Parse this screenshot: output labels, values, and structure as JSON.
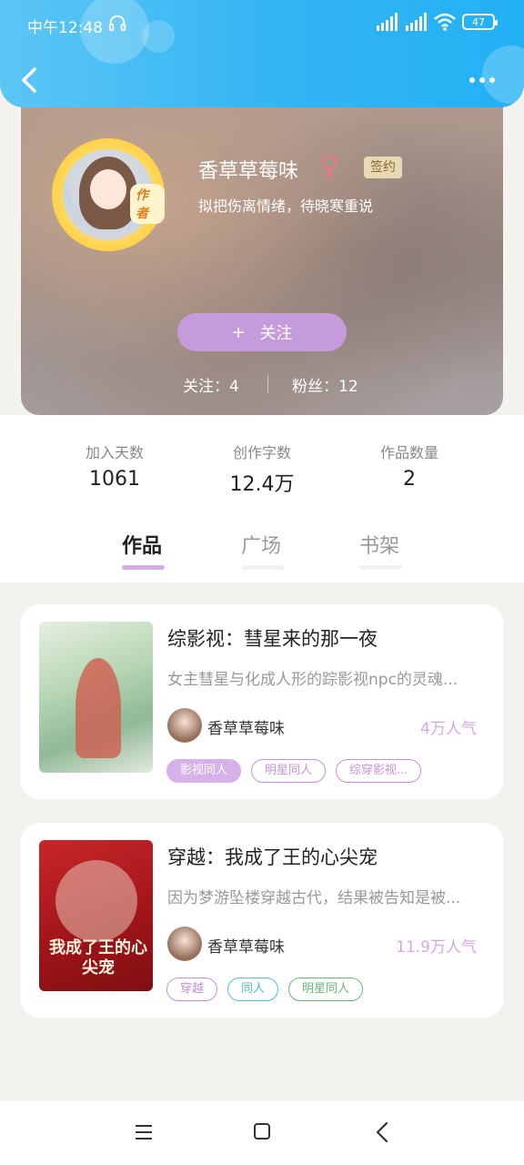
{
  "status": {
    "time": "中午12:48",
    "battery": "47"
  },
  "profile": {
    "author_badge": "作者",
    "name": "香草草莓味",
    "sign_badge": "签约",
    "motto": "拟把伤离情绪，待晓寒重说",
    "follow_label": "关注",
    "following": "关注：4",
    "fans": "粉丝：12"
  },
  "stats": [
    {
      "label": "加入天数",
      "value": "1061"
    },
    {
      "label": "创作字数",
      "value": "12.4万"
    },
    {
      "label": "作品数量",
      "value": "2"
    }
  ],
  "tabs": [
    "作品",
    "广场",
    "书架"
  ],
  "active_tab": 0,
  "books": [
    {
      "title": "综影视：彗星来的那一夜",
      "desc": "女主彗星与化成人形的踪影视npc的灵魂...",
      "author": "香草草莓味",
      "popularity": "4万人气",
      "tags": [
        "影视同人",
        "明星同人",
        "综穿影视..."
      ]
    },
    {
      "title": "穿越：我成了王的心尖宠",
      "desc": "因为梦游坠楼穿越古代，结果被告知是被...",
      "author": "香草草莓味",
      "popularity": "11.9万人气",
      "cover_text": "我成了王的心尖宠",
      "tags": [
        "穿越",
        "同人",
        "明星同人"
      ]
    }
  ],
  "colors": {
    "header": "#36b5f3",
    "accent": "#c59bdc",
    "popularity": "#d4a8e4"
  }
}
